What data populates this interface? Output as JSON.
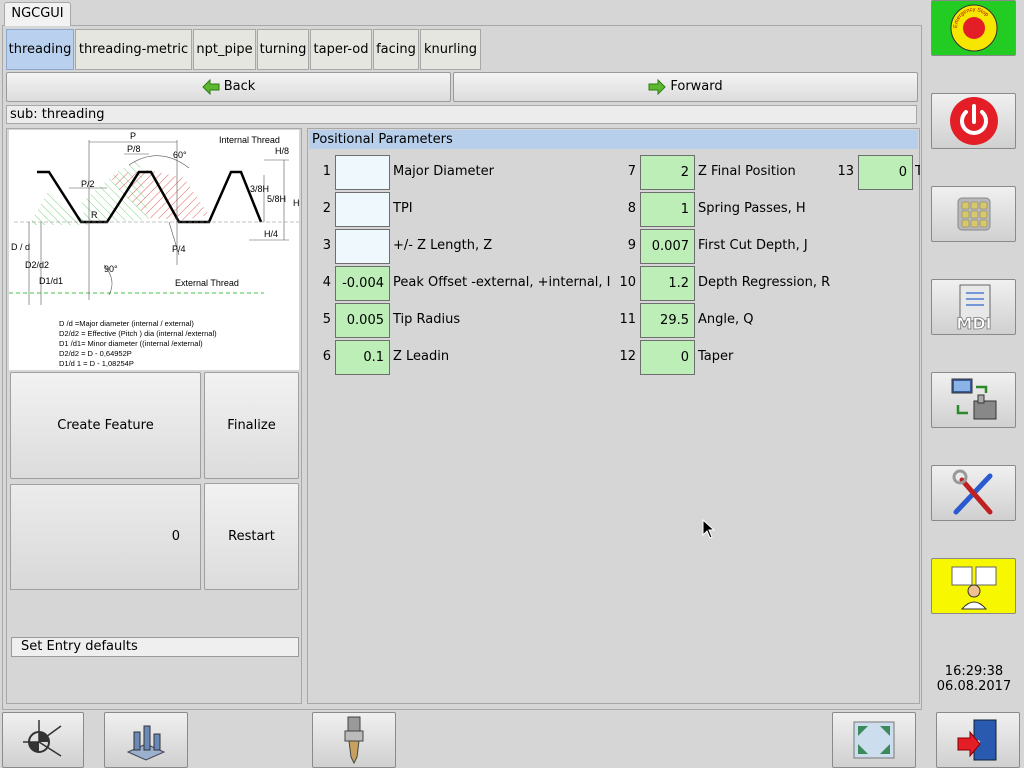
{
  "window": {
    "tab_label": "NGCGUI"
  },
  "subtabs": [
    {
      "label": "threading",
      "active": true
    },
    {
      "label": "threading-metric"
    },
    {
      "label": "npt_pipe"
    },
    {
      "label": "turning"
    },
    {
      "label": "taper-od"
    },
    {
      "label": "facing"
    },
    {
      "label": "knurling"
    }
  ],
  "nav": {
    "back_label": "Back",
    "forward_label": "Forward"
  },
  "sub_label": "sub: threading",
  "diagram": {
    "labels": {
      "p": "P",
      "p8": "P/8",
      "deg60": "60°",
      "internal": "Internal Thread",
      "h8": "H/8",
      "p2": "P/2",
      "h38": "3/8H",
      "h58": "5/8H",
      "h": "H",
      "r": "R",
      "dd": "D / d",
      "h4": "H/4",
      "p4": "P/4",
      "d2": "D2/d2",
      "d1": "D1/d1",
      "deg90": "90°",
      "external": "External Thread"
    },
    "legend": [
      "D /d =Major diameter (internal / external)",
      "D2/d2 = Effective (Pitch ) dia (internal /external)",
      "D1 /d1= Minor diameter  ((internal /external)",
      "D2/d2  = D - 0,64952P",
      "D1/d 1 = D - 1,08254P"
    ]
  },
  "buttons": {
    "create_feature": "Create Feature",
    "finalize": "Finalize",
    "counter": "0",
    "restart": "Restart",
    "set_defaults": "Set Entry defaults"
  },
  "params": {
    "header": "Positional Parameters",
    "items": [
      {
        "num": "1",
        "value": "",
        "label": "Major Diameter"
      },
      {
        "num": "2",
        "value": "",
        "label": "TPI"
      },
      {
        "num": "3",
        "value": "",
        "label": "+/- Z Length, Z"
      },
      {
        "num": "4",
        "value": "-0.004",
        "label": "Peak Offset -external, +internal, I"
      },
      {
        "num": "5",
        "value": "0.005",
        "label": "Tip Radius"
      },
      {
        "num": "6",
        "value": "0.1",
        "label": "Z Leadin"
      },
      {
        "num": "7",
        "value": "2",
        "label": "Z Final Position"
      },
      {
        "num": "8",
        "value": "1",
        "label": "Spring Passes, H"
      },
      {
        "num": "9",
        "value": "0.007",
        "label": "First Cut Depth, J"
      },
      {
        "num": "10",
        "value": "1.2",
        "label": "Depth Regression, R"
      },
      {
        "num": "11",
        "value": "29.5",
        "label": "Angle, Q"
      },
      {
        "num": "12",
        "value": "0",
        "label": "Taper"
      },
      {
        "num": "13",
        "value": "0",
        "label": "T"
      }
    ]
  },
  "sidebar": {
    "icons": [
      "emergency-stop-icon",
      "power-icon",
      "jog-keypad-icon",
      "mdi-icon",
      "machine-transfer-icon",
      "tools-settings-icon",
      "user-tabs-icon"
    ],
    "mdi_text": "MDI",
    "estop_text": "Emergency Stop"
  },
  "clock": {
    "time": "16:29:38",
    "date": "06.08.2017"
  },
  "bottom": {
    "icons": [
      "axis-jog-icon",
      "touch-off-icon",
      "tool-icon",
      "fullscreen-icon",
      "exit-icon"
    ]
  },
  "colors": {
    "active_tab": "#b9d1ee",
    "field_filled": "#bdeeb8",
    "field_empty": "#eef8fd",
    "estop_bg": "#22cc22",
    "user_bg": "#f7f700",
    "power_red": "#e41e26"
  }
}
